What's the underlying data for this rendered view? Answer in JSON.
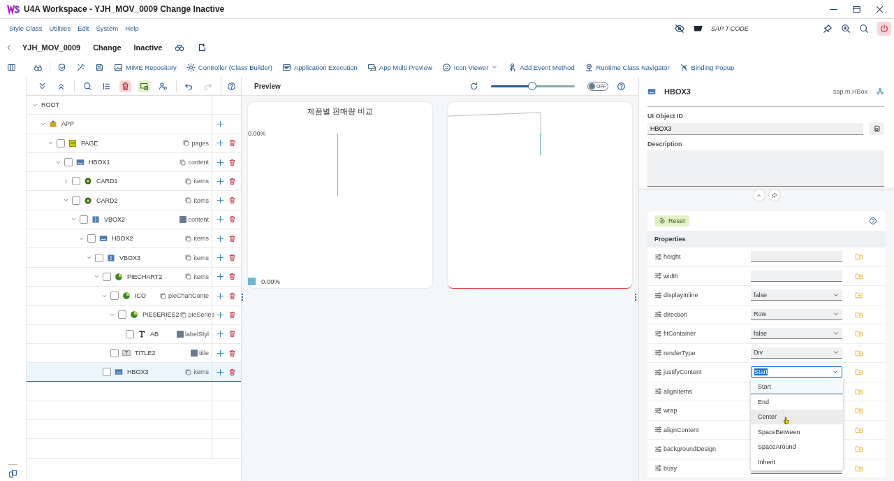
{
  "window": {
    "title": "U4A Workspace - YJH_MOV_0009 Change Inactive"
  },
  "menu": [
    "Style Class",
    "Utilities",
    "Edit",
    "System",
    "Help"
  ],
  "tcode": {
    "placeholder": "SAP T-CODE"
  },
  "header": {
    "program": "YJH_MOV_0009",
    "mode": "Change",
    "status": "Inactive"
  },
  "toolbar": [
    {
      "kind": "icon"
    },
    {
      "kind": "icon"
    },
    {
      "kind": "icon"
    },
    {
      "kind": "icon"
    },
    {
      "kind": "button",
      "label": "MIME Repository"
    },
    {
      "kind": "button",
      "label": "Controller (Class Builder)"
    },
    {
      "kind": "button",
      "label": "Application Execution"
    },
    {
      "kind": "button",
      "label": "App Multi Preview"
    },
    {
      "kind": "button",
      "label": "Icon Viewer",
      "menu": true
    },
    {
      "kind": "button",
      "label": "Add Event Method"
    },
    {
      "kind": "button",
      "label": "Runtime Class Navigator"
    },
    {
      "kind": "button",
      "label": "Binding Popup"
    }
  ],
  "tree": [
    {
      "name": "ROOT",
      "expanded": true,
      "selected": false,
      "children": [
        {
          "name": "APP",
          "kind": "app",
          "expanded": true,
          "selected": false,
          "add": true,
          "children": [
            {
              "name": "PAGE",
              "kind": "page",
              "aggregation": "pages",
              "multiple": true,
              "checked": false,
              "expanded": true,
              "selected": false,
              "add": true,
              "delete": true,
              "children": [
                {
                  "name": "HBOX1",
                  "kind": "hbox",
                  "aggregation": "content",
                  "multiple": true,
                  "checked": false,
                  "expanded": true,
                  "selected": false,
                  "add": true,
                  "delete": true,
                  "children": [
                    {
                      "name": "CARD1",
                      "kind": "card",
                      "aggregation": "items",
                      "multiple": true,
                      "checked": false,
                      "expanded": false,
                      "selected": false,
                      "add": true,
                      "delete": true
                    },
                    {
                      "name": "CARD2",
                      "kind": "card",
                      "aggregation": "items",
                      "multiple": true,
                      "checked": false,
                      "expanded": true,
                      "selected": false,
                      "add": true,
                      "delete": true,
                      "children": [
                        {
                          "name": "VBOX2",
                          "kind": "vbox",
                          "aggregation": "content",
                          "multiple": false,
                          "checked": false,
                          "expanded": true,
                          "selected": false,
                          "add": true,
                          "delete": true,
                          "children": [
                            {
                              "name": "HBOX2",
                              "kind": "hbox",
                              "aggregation": "items",
                              "multiple": true,
                              "checked": false,
                              "expanded": true,
                              "selected": false,
                              "add": true,
                              "delete": true,
                              "children": [
                                {
                                  "name": "VBOX3",
                                  "kind": "vbox",
                                  "aggregation": "items",
                                  "multiple": true,
                                  "checked": false,
                                  "expanded": true,
                                  "selected": false,
                                  "add": true,
                                  "delete": true,
                                  "children": [
                                    {
                                      "name": "PIECHART2",
                                      "kind": "chart",
                                      "aggregation": "items",
                                      "multiple": true,
                                      "checked": false,
                                      "expanded": true,
                                      "selected": false,
                                      "add": true,
                                      "delete": true,
                                      "children": [
                                        {
                                          "name": "ICO",
                                          "kind": "chart",
                                          "aggregation": "pieChartConte",
                                          "multiple": true,
                                          "checked": false,
                                          "expanded": true,
                                          "selected": false,
                                          "add": true,
                                          "delete": true,
                                          "children": [
                                            {
                                              "name": "PIESERIES2",
                                              "kind": "chart",
                                              "aggregation": "pieSeries",
                                              "multiple": true,
                                              "checked": false,
                                              "expanded": true,
                                              "selected": false,
                                              "add": true,
                                              "delete": true,
                                              "children": [
                                                {
                                                  "name": "AB",
                                                  "kind": "text",
                                                  "aggregation": "labelStyl",
                                                  "multiple": false,
                                                  "checked": false,
                                                  "selected": false,
                                                  "add": true,
                                                  "delete": true
                                                }
                                              ]
                                            }
                                          ]
                                        },
                                        {
                                          "name": "TITLE2",
                                          "kind": "title",
                                          "aggregation": "title",
                                          "multiple": false,
                                          "checked": false,
                                          "selected": false,
                                          "add": true,
                                          "delete": true
                                        }
                                      ]
                                    },
                                    {
                                      "name": "HBOX3",
                                      "kind": "hbox",
                                      "aggregation": "items",
                                      "multiple": true,
                                      "checked": false,
                                      "selected": true,
                                      "add": true,
                                      "delete": true
                                    }
                                  ]
                                }
                              ]
                            }
                          ]
                        }
                      ]
                    }
                  ]
                }
              ]
            }
          ]
        }
      ]
    }
  ],
  "preview": {
    "title": "Preview",
    "zoom": {
      "level": 0.49
    },
    "toggle": {
      "label": "OFF",
      "on": false
    },
    "cards": [
      {
        "kind": "chart",
        "title": "제품별 판매량 비교",
        "axis_label": "0.00%",
        "legend": "0.00%"
      },
      {
        "kind": "empty"
      }
    ]
  },
  "object": {
    "name": "HBOX3",
    "class": "sap.m.HBox",
    "id_label": "UI Object ID",
    "id": "HBOX3",
    "description_label": "Description"
  },
  "properties": {
    "reset": "Reset",
    "title": "Properties",
    "rows": [
      {
        "name": "height",
        "kind": "input"
      },
      {
        "name": "width",
        "kind": "input"
      },
      {
        "name": "displayInline",
        "kind": "select",
        "value": "false"
      },
      {
        "name": "direction",
        "kind": "select",
        "value": "Row"
      },
      {
        "name": "fitContainer",
        "kind": "select",
        "value": "false"
      },
      {
        "name": "renderType",
        "kind": "select",
        "value": "Div"
      },
      {
        "name": "justifyContent",
        "kind": "select",
        "value": "Start",
        "open": true
      },
      {
        "name": "alignItems",
        "kind": "covered"
      },
      {
        "name": "wrap",
        "kind": "covered"
      },
      {
        "name": "alignContent",
        "kind": "covered"
      },
      {
        "name": "backgroundDesign",
        "kind": "covered"
      },
      {
        "name": "busy",
        "kind": "select"
      }
    ],
    "dropdown": [
      {
        "label": "Start",
        "selected": true,
        "hovered": false
      },
      {
        "label": "End",
        "selected": false,
        "hovered": false
      },
      {
        "label": "Center",
        "selected": false,
        "hovered": true
      },
      {
        "label": "SpaceBetween",
        "selected": false,
        "hovered": false
      },
      {
        "label": "SpaceAround",
        "selected": false,
        "hovered": false
      },
      {
        "label": "Inherit",
        "selected": false,
        "hovered": false
      }
    ]
  }
}
